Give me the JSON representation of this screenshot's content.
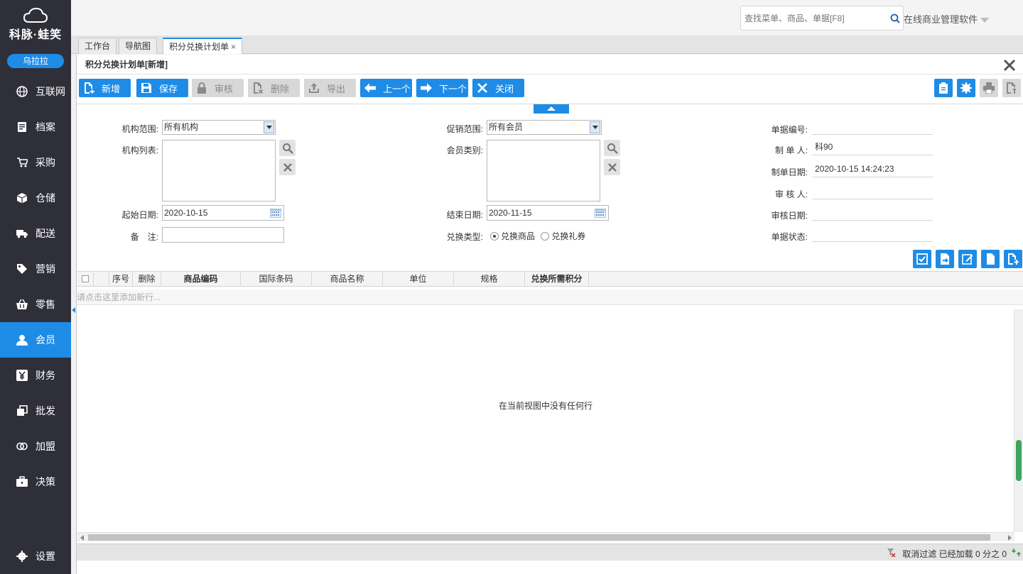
{
  "sidebar": {
    "logo_text": "科脉·蛙笑",
    "user": "乌拉拉",
    "items": [
      {
        "label": "互联网",
        "icon": "globe-icon"
      },
      {
        "label": "档案",
        "icon": "archive-icon"
      },
      {
        "label": "采购",
        "icon": "cart-icon"
      },
      {
        "label": "仓储",
        "icon": "box-icon"
      },
      {
        "label": "配送",
        "icon": "truck-icon"
      },
      {
        "label": "营销",
        "icon": "tag-icon"
      },
      {
        "label": "零售",
        "icon": "basket-icon"
      },
      {
        "label": "会员",
        "icon": "user-icon",
        "active": true
      },
      {
        "label": "财务",
        "icon": "yen-icon"
      },
      {
        "label": "批发",
        "icon": "copy-icon"
      },
      {
        "label": "加盟",
        "icon": "rings-icon"
      },
      {
        "label": "决策",
        "icon": "briefcase-icon"
      }
    ],
    "settings": "设置"
  },
  "topbar": {
    "search_placeholder": "查找菜单、商品、单据[F8]",
    "brand_menu": "在线商业管理软件"
  },
  "tabs": [
    {
      "label": "工作台"
    },
    {
      "label": "导航图"
    },
    {
      "label": "积分兑换计划单",
      "active": true,
      "closable": "×"
    }
  ],
  "panel": {
    "title": "积分兑换计划单[新增]",
    "toolbar": {
      "new": "新增",
      "save": "保存",
      "audit": "审核",
      "delete": "删除",
      "export": "导出",
      "prev": "上一个",
      "next": "下一个",
      "close": "关闭"
    }
  },
  "form": {
    "org_scope_label": "机构范围:",
    "org_scope_value": "所有机构",
    "org_list_label": "机构列表:",
    "start_date_label": "起始日期:",
    "start_date_value": "2020-10-15",
    "remark_label": "备　注:",
    "promo_scope_label": "促销范围:",
    "promo_scope_value": "所有会员",
    "member_type_label": "会员类别:",
    "end_date_label": "结束日期:",
    "end_date_value": "2020-11-15",
    "exchange_type_label": "兑换类型:",
    "exchange_goods": "兑换商品",
    "exchange_coupon": "兑换礼券",
    "doc_no_label": "单据编号:",
    "creator_label": "制 单 人:",
    "creator_value": "科90",
    "create_date_label": "制单日期:",
    "create_date_value": "2020-10-15 14:24:23",
    "auditor_label": "审 核 人:",
    "audit_date_label": "审核日期:",
    "doc_status_label": "单据状态:"
  },
  "grid": {
    "columns": [
      "序号",
      "删除",
      "商品编码",
      "国际条码",
      "商品名称",
      "单位",
      "规格",
      "兑换所需积分"
    ],
    "add_row_hint": "请点击这里添加新行...",
    "empty_message": "在当前视图中没有任何行"
  },
  "status": {
    "cancel_filter": "取消过滤",
    "loaded": "已经加载 0 分之 0"
  },
  "colors": {
    "accent": "#1e8ce6",
    "sidebar_bg": "#2f2f3a",
    "scroll_thumb": "#3da55d"
  }
}
